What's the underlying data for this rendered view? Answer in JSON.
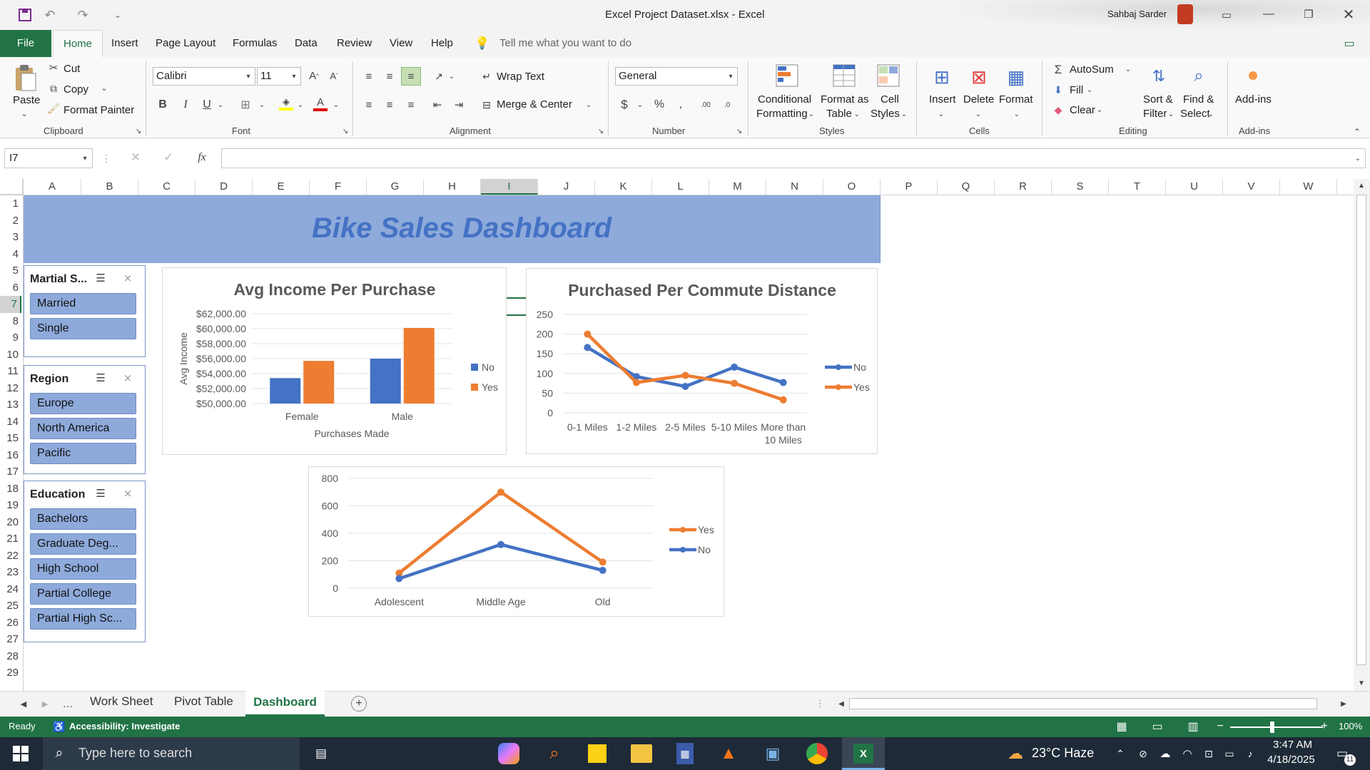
{
  "window": {
    "title": "Excel Project Dataset.xlsx  -  Excel",
    "user": "Sahbaj Sarder"
  },
  "tabs": [
    "File",
    "Home",
    "Insert",
    "Page Layout",
    "Formulas",
    "Data",
    "Review",
    "View",
    "Help"
  ],
  "tell_me": "Tell me what you want to do",
  "ribbon": {
    "clipboard": {
      "paste": "Paste",
      "cut": "Cut",
      "copy": "Copy",
      "format_painter": "Format Painter",
      "label": "Clipboard"
    },
    "font": {
      "name": "Calibri",
      "size": "11",
      "label": "Font"
    },
    "alignment": {
      "wrap": "Wrap Text",
      "merge": "Merge & Center",
      "label": "Alignment"
    },
    "number": {
      "format": "General",
      "label": "Number"
    },
    "styles": {
      "cond1": "Conditional",
      "cond2": "Formatting",
      "fmt1": "Format as",
      "fmt2": "Table",
      "cell1": "Cell",
      "cell2": "Styles",
      "label": "Styles"
    },
    "cells": {
      "insert": "Insert",
      "delete": "Delete",
      "format": "Format",
      "label": "Cells"
    },
    "editing": {
      "autosum": "AutoSum",
      "fill": "Fill",
      "clear": "Clear",
      "sort1": "Sort &",
      "sort2": "Filter",
      "find1": "Find &",
      "find2": "Select",
      "label": "Editing"
    },
    "addins": {
      "name": "Add-ins",
      "label": "Add-ins"
    }
  },
  "formula_bar": {
    "name_box": "I7",
    "fx": "fx",
    "value": ""
  },
  "columns": [
    "A",
    "B",
    "C",
    "D",
    "E",
    "F",
    "G",
    "H",
    "I",
    "J",
    "K",
    "L",
    "M",
    "N",
    "O",
    "P",
    "Q",
    "R",
    "S",
    "T",
    "U",
    "V",
    "W"
  ],
  "rows": [
    "1",
    "2",
    "3",
    "4",
    "5",
    "6",
    "7",
    "8",
    "9",
    "10",
    "11",
    "12",
    "13",
    "14",
    "15",
    "16",
    "17",
    "18",
    "19",
    "20",
    "21",
    "22",
    "23",
    "24",
    "25",
    "26",
    "27",
    "28",
    "29"
  ],
  "dashboard_title": "Bike Sales Dashboard",
  "slicers": [
    {
      "title": "Martial S...",
      "items": [
        "Married",
        "Single"
      ]
    },
    {
      "title": "Region",
      "items": [
        "Europe",
        "North America",
        "Pacific"
      ]
    },
    {
      "title": "Education",
      "items": [
        "Bachelors",
        "Graduate Deg...",
        "High School",
        "Partial College",
        "Partial High Sc..."
      ]
    }
  ],
  "colors": {
    "blue": "#4472c4",
    "orange": "#ed7d31",
    "excel_green": "#217346",
    "banner": "#8eaadb",
    "title_blue": "#4472c4"
  },
  "chart_data": [
    {
      "type": "bar",
      "title": "Avg Income Per Purchase",
      "xlabel": "Purchases Made",
      "ylabel": "Avg Income",
      "categories": [
        "Female",
        "Male"
      ],
      "series": [
        {
          "name": "No",
          "values": [
            53400,
            56000
          ]
        },
        {
          "name": "Yes",
          "values": [
            55700,
            60100
          ]
        }
      ],
      "ylim": [
        50000,
        62000
      ],
      "yticks": [
        "$50,000.00",
        "$52,000.00",
        "$54,000.00",
        "$56,000.00",
        "$58,000.00",
        "$60,000.00",
        "$62,000.00"
      ],
      "legend": "right"
    },
    {
      "type": "line",
      "title": "Purchased Per Commute Distance",
      "categories": [
        "0-1 Miles",
        "1-2 Miles",
        "2-5 Miles",
        "5-10 Miles",
        "More than 10 Miles"
      ],
      "series": [
        {
          "name": "No",
          "values": [
            166,
            92,
            67,
            116,
            77
          ]
        },
        {
          "name": "Yes",
          "values": [
            200,
            77,
            95,
            75,
            33
          ]
        }
      ],
      "ylim": [
        0,
        250
      ],
      "yticks": [
        "0",
        "50",
        "100",
        "150",
        "200",
        "250"
      ],
      "legend": "right"
    },
    {
      "type": "line",
      "title": "",
      "categories": [
        "Adolescent",
        "Middle Age",
        "Old"
      ],
      "series": [
        {
          "name": "Yes",
          "values": [
            110,
            700,
            190
          ]
        },
        {
          "name": "No",
          "values": [
            70,
            318,
            130
          ]
        }
      ],
      "ylim": [
        0,
        800
      ],
      "yticks": [
        "0",
        "200",
        "400",
        "600",
        "800"
      ],
      "legend": "right"
    }
  ],
  "sheets": [
    "Work Sheet",
    "Pivot Table",
    "Dashboard"
  ],
  "status": {
    "ready": "Ready",
    "accessibility": "Accessibility: Investigate",
    "zoom": "100%"
  },
  "taskbar": {
    "search": "Type here to search",
    "weather": "23°C  Haze",
    "time": "3:47 AM",
    "date": "4/18/2025",
    "notif": "11"
  }
}
